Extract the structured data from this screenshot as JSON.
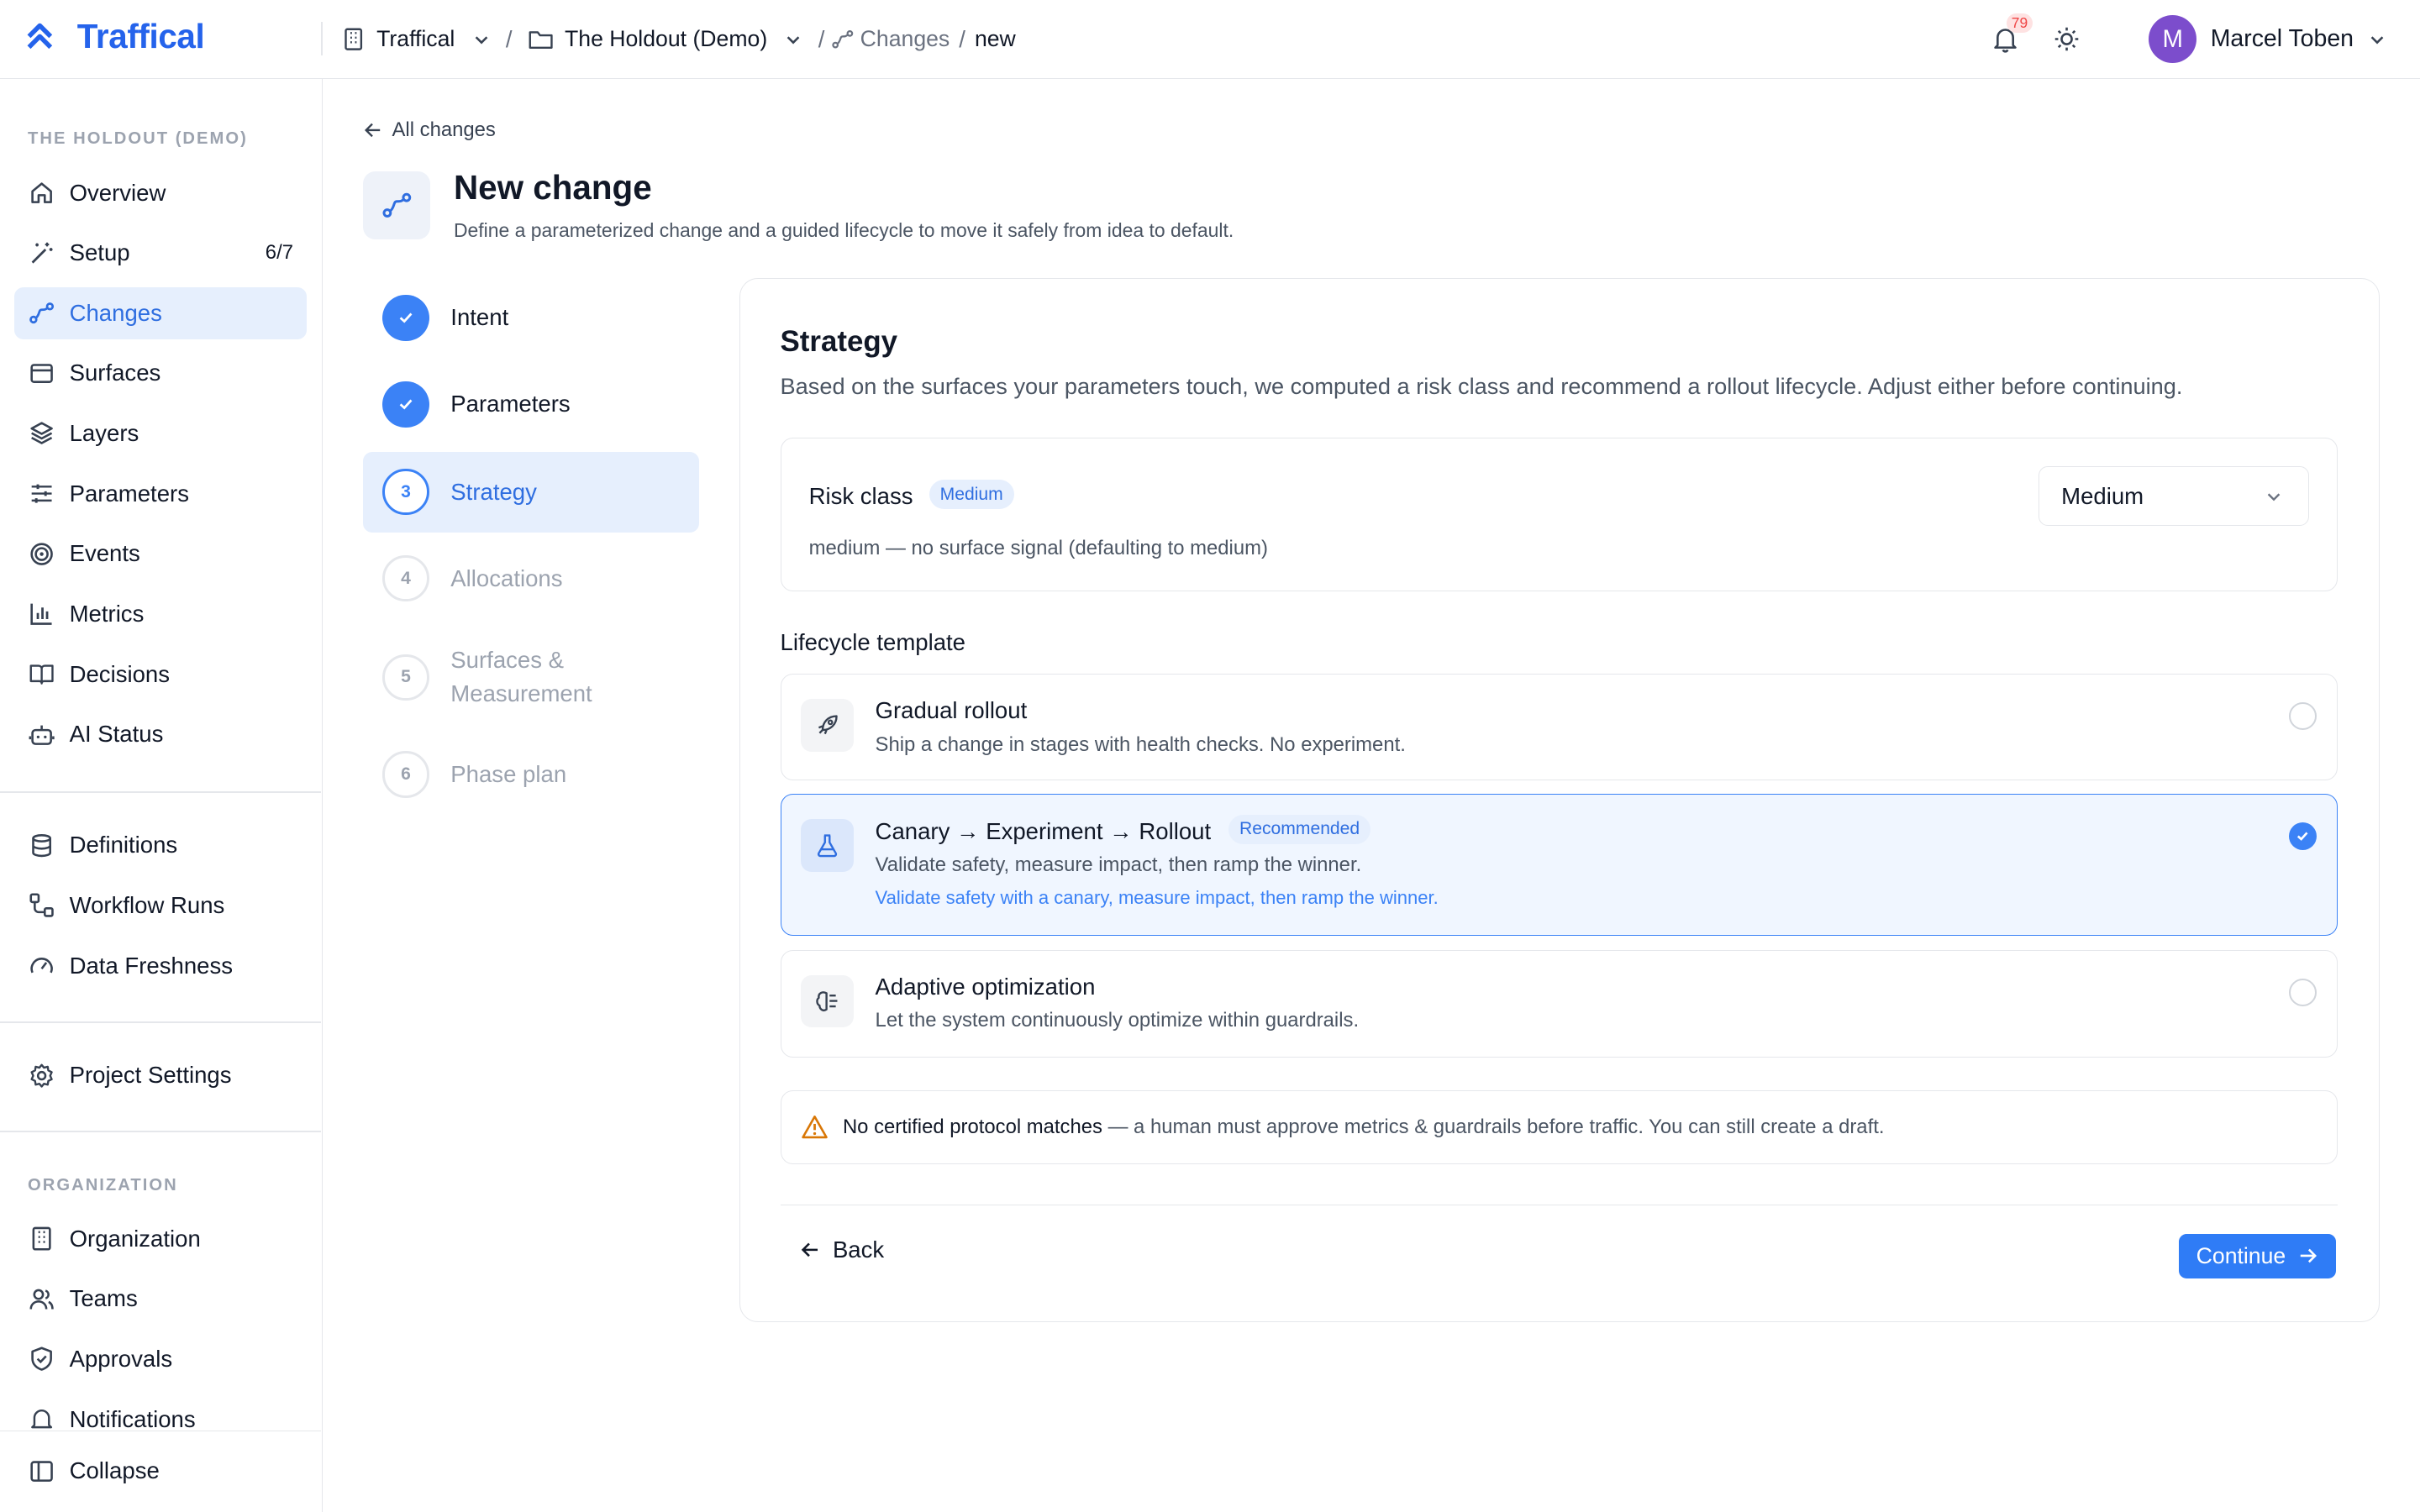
{
  "topbar": {
    "brand": "Traffical",
    "org": "Traffical",
    "project": "The Holdout (Demo)",
    "section": "Changes",
    "current": "new",
    "notification_count": "79",
    "user_initial": "M",
    "user_name": "Marcel Toben"
  },
  "sidebar": {
    "project_label": "THE HOLDOUT (DEMO)",
    "items": [
      {
        "label": "Overview",
        "icon": "home-icon"
      },
      {
        "label": "Setup",
        "icon": "wand-icon",
        "count": "6/7"
      },
      {
        "label": "Changes",
        "icon": "changes-icon",
        "active": true
      },
      {
        "label": "Surfaces",
        "icon": "surface-icon"
      },
      {
        "label": "Layers",
        "icon": "layers-icon"
      },
      {
        "label": "Parameters",
        "icon": "sliders-icon"
      },
      {
        "label": "Events",
        "icon": "target-icon"
      },
      {
        "label": "Metrics",
        "icon": "bar-chart-icon"
      },
      {
        "label": "Decisions",
        "icon": "book-icon"
      },
      {
        "label": "AI Status",
        "icon": "bot-icon"
      }
    ],
    "items2": [
      {
        "label": "Definitions",
        "icon": "database-icon"
      },
      {
        "label": "Workflow Runs",
        "icon": "workflow-icon"
      },
      {
        "label": "Data Freshness",
        "icon": "gauge-icon"
      }
    ],
    "items3": [
      {
        "label": "Project Settings",
        "icon": "gear-icon"
      }
    ],
    "org_label": "ORGANIZATION",
    "org_items": [
      {
        "label": "Organization",
        "icon": "building-icon"
      },
      {
        "label": "Teams",
        "icon": "users-icon"
      },
      {
        "label": "Approvals",
        "icon": "shield-icon"
      },
      {
        "label": "Notifications",
        "icon": "bell-icon"
      }
    ],
    "collapse_label": "Collapse"
  },
  "page": {
    "back_label": "All changes",
    "title": "New change",
    "subtitle": "Define a parameterized change and a guided lifecycle to move it safely from idea to default."
  },
  "steps": [
    {
      "num": "1",
      "label": "Intent",
      "state": "done"
    },
    {
      "num": "2",
      "label": "Parameters",
      "state": "done"
    },
    {
      "num": "3",
      "label": "Strategy",
      "state": "current"
    },
    {
      "num": "4",
      "label": "Allocations",
      "state": "todo"
    },
    {
      "num": "5",
      "label": "Surfaces & Measurement",
      "state": "todo"
    },
    {
      "num": "6",
      "label": "Phase plan",
      "state": "todo"
    }
  ],
  "strategy": {
    "title": "Strategy",
    "subtitle": "Based on the surfaces your parameters touch, we computed a risk class and recommend a rollout lifecycle. Adjust either before continuing.",
    "risk_label": "Risk class",
    "risk_badge": "Medium",
    "risk_note": "medium — no surface signal (defaulting to medium)",
    "risk_select": "Medium",
    "lifecycle_label": "Lifecycle template",
    "options": [
      {
        "title": "Gradual rollout",
        "desc": "Ship a change in stages with health checks. No experiment.",
        "icon": "rocket-icon",
        "selected": false
      },
      {
        "title": "Canary → Experiment → Rollout",
        "badge": "Recommended",
        "desc": "Validate safety, measure impact, then ramp the winner.",
        "note": "Validate safety with a canary, measure impact, then ramp the winner.",
        "icon": "flask-icon",
        "selected": true
      },
      {
        "title": "Adaptive optimization",
        "desc": "Let the system continuously optimize within guardrails.",
        "icon": "brain-icon",
        "selected": false
      }
    ],
    "warning_strong": "No certified protocol matches",
    "warning_rest": " — a human must approve metrics & guardrails before traffic. You can still create a draft.",
    "back_button": "Back",
    "continue_button": "Continue"
  },
  "colors": {
    "accent": "#2f7cf6",
    "active_bg": "#e6effd",
    "avatar": "#7c4dcc",
    "warning": "#d97706"
  }
}
